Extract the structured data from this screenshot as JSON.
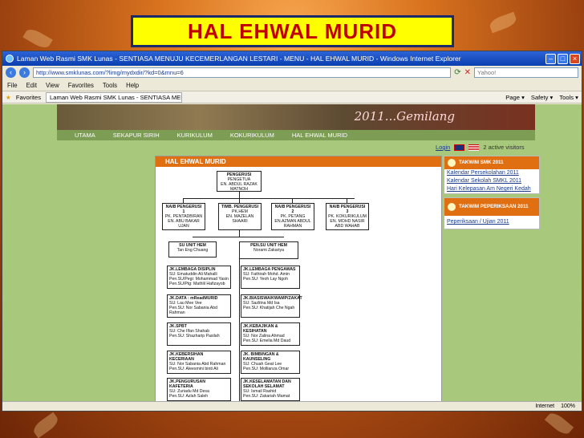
{
  "slide": {
    "title": "HAL EHWAL MURID"
  },
  "window": {
    "title": "Laman Web Rasmi SMK Lunas - SENTIASA MENUJU KECEMERLANGAN LESTARI - MENU - HAL EHWAL MURID - Windows Internet Explorer"
  },
  "address": {
    "url": "http://www.smklunas.com/?limg/mydxdir/?kd=0&mnu=6",
    "search_placeholder": "Yahoo!"
  },
  "menu": [
    "File",
    "Edit",
    "View",
    "Favorites",
    "Tools",
    "Help"
  ],
  "favbar": {
    "favorites": "Favorites",
    "tab": "Laman Web Rasmi SMK Lunas - SENTIASA MENUJU KE...",
    "tools": [
      "Page ▾",
      "Safety ▾",
      "Tools ▾"
    ]
  },
  "site": {
    "banner_year": "2011...Gemilang",
    "nav": [
      "UTAMA",
      "SEKAPUR SIRIH",
      "KURIKULUM",
      "KOKURIKULUM",
      "HAL EHWAL MURID"
    ],
    "login": "Login",
    "visitors": "2 active visitors",
    "content_title": "HAL EHWAL MURID"
  },
  "org": {
    "top": {
      "role": "PENGERUSI",
      "title": "PENGETUA",
      "name": "EN. ABDUL RAZAK MATNOH"
    },
    "deputies": [
      {
        "role": "NAIB PENGERUSI 1",
        "title": "PK. PENTADBIRAN",
        "name": "EN. ABU BAKAR UJAN"
      },
      {
        "role": "TIMB. PENGERUSI",
        "title": "PK.HEM",
        "name": "EN. MAZELAN SHAARI"
      },
      {
        "role": "NAIB PENGERUSI 2",
        "title": "PK. PETANG",
        "name": "EN.AZMAN ABDUL RAHMAN"
      },
      {
        "role": "NAIB PENGERUSI 3",
        "title": "PK. KOKURIKULUM",
        "name": "EN. MOHD NASIR ABD WAHAB"
      }
    ],
    "su": {
      "role": "SU UNIT HEM",
      "name": "Tan Eng Chuang"
    },
    "pensu": {
      "role": "PEN.SU UNIT HEM",
      "name": "Norami Zakariya"
    },
    "left": [
      {
        "head": "JK.LEMBAGA DISIPLIN",
        "lines": [
          "SU: Ematuddin Ali Mahalli",
          "Pen.SU/Pegi: Mohammad Yasin",
          "Pen.SU/Ptg: Mathlil Hafizayob"
        ]
      },
      {
        "head": "JK.DATA : mReadMURID",
        "lines": [
          "SU: Lau Mee Vee",
          "Pen.SU: Nor Sabania Abd Rahman"
        ]
      },
      {
        "head": "JK.SPBT",
        "lines": [
          "SU: Che Ilfan Shahab",
          "Pen.SU: Shazharip Pasilah"
        ]
      },
      {
        "head": "JK.KEBERSIHAN KECERIAAN",
        "lines": [
          "SU: Nor Sabania Abd Rahman",
          "Pen.SU: Aleesmini binti Ali"
        ]
      },
      {
        "head": "JK.PENGURUSAN KAFETERIA",
        "lines": [
          "SU: Zuriadu Md Desa",
          "Pen.SU: Azlah Saleh"
        ]
      }
    ],
    "right": [
      {
        "head": "JK.LEMBAGA PENGAWAS",
        "lines": [
          "SU: Fathirah Mohd. Amin",
          "Pen.SU: Yeoh Lay Ngoh"
        ]
      },
      {
        "head": "JK.BIASISWA/KWAMP/ZAKAT",
        "lines": [
          "SU: Sazlitna Md Isa",
          "Pen.SU: Khatijah Che Ngah"
        ]
      },
      {
        "head": "JK.KEBAJIKAN & KESIHATAN",
        "lines": [
          "SU: Nor Zalina Ahmad",
          "Pen.SU: Emelia Md Daud"
        ]
      },
      {
        "head": "JK. BIMBINGAN & KAUNSELING",
        "lines": [
          "SU: Chuah Geat Lee",
          "Pen.SU: Mollianza Omar"
        ]
      },
      {
        "head": "JK.KESELAMATAN DAN SEKOLAH SELAMAT",
        "lines": [
          "SU: Ismail Rashid",
          "Pen.SU: Zakariah Mamat"
        ]
      }
    ]
  },
  "sidebar": {
    "panel1": {
      "title": "TAKWIM SMK 2011",
      "links": [
        "Kalendar Persekolahan 2011",
        "Kalendar Sekolah SMKL 2011",
        "Hari Kelepasan Am Negeri Kedah"
      ]
    },
    "panel2": {
      "title": "TAKWIM PEPERIKSAAN 2011",
      "links": [
        "Peperiksaan / Ujian 2011"
      ]
    }
  },
  "status": {
    "zone": "Internet",
    "zoom": "100%"
  }
}
